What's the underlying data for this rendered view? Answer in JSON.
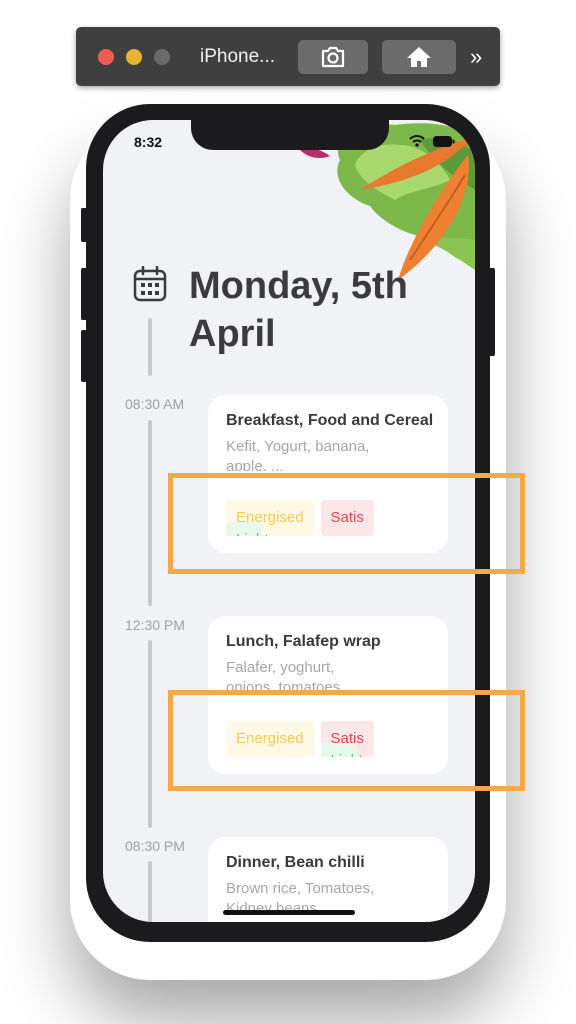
{
  "simulator": {
    "title": "iPhone...",
    "more_label": "»"
  },
  "status_bar": {
    "time": "8:32"
  },
  "header": {
    "date_title": "Monday, 5th April"
  },
  "entries": [
    {
      "time": "08:30 AM",
      "title": "Breakfast, Food and Cereal",
      "description": "Kefit, Yogurt, banana, apple, ...",
      "tags": [
        "Light",
        "Energised",
        "Satis"
      ]
    },
    {
      "time": "12:30 PM",
      "title": "Lunch, Falafep wrap",
      "description": "Falafer, yoghurt, onions, tomatoes",
      "tags": [
        "Energised",
        "Light",
        "Satis"
      ]
    },
    {
      "time": "08:30 PM",
      "title": "Dinner, Bean chilli",
      "description": "Brown rice, Tomatoes, Kidney beans"
    }
  ],
  "colors": {
    "highlight": "#f1a94a",
    "tag_light": "#5bc46f",
    "tag_energised": "#f3ca52",
    "tag_satisfied": "#e0454f",
    "background": "#f1f2f6"
  },
  "icons": [
    "camera-icon",
    "home-icon",
    "calendar-icon",
    "wifi-icon",
    "battery-icon"
  ]
}
